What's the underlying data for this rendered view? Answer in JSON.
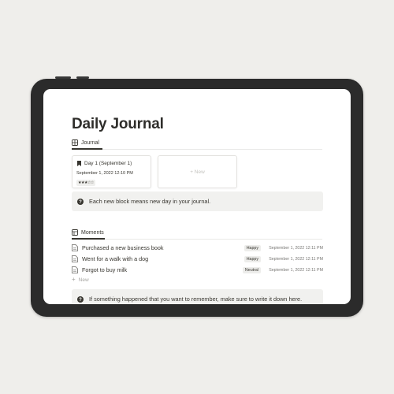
{
  "page": {
    "title": "Daily Journal"
  },
  "journal": {
    "view_label": "Journal",
    "card": {
      "title": "Day 1 (September 1)",
      "date": "September 1, 2022 12:10 PM",
      "rating": "★★★☆☆"
    },
    "new_card_label": "+ New"
  },
  "callout_top": {
    "text": "Each new block means new day in your journal."
  },
  "moments": {
    "view_label": "Moments",
    "rows": [
      {
        "name": "Purchased a new business book",
        "tag": "Happy",
        "date": "September 1, 2022 12:11 PM"
      },
      {
        "name": "Went for a walk with a dog",
        "tag": "Happy",
        "date": "September 1, 2022 12:11 PM"
      },
      {
        "name": "Forgot to buy milk",
        "tag": "Neutral",
        "date": "September 1, 2022 12:11 PM"
      }
    ],
    "new_label": "New"
  },
  "callout_bottom": {
    "text": "If something happened that you want to remember, make sure to write it down here."
  },
  "icons": {
    "journal_view": "gallery-icon",
    "card": "bookmark-icon",
    "callout": "question-circle-icon",
    "moments_view": "table-icon",
    "row": "document-icon",
    "new": "plus-icon"
  },
  "colors": {
    "background": "#efeeeb",
    "device": "#2b2b2b",
    "text": "#37352f",
    "callout_bg": "#f1f1ef"
  }
}
